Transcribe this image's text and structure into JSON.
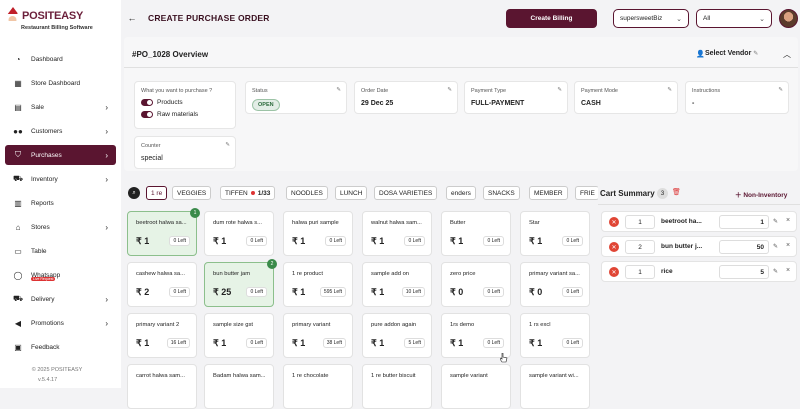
{
  "brand": {
    "name": "POSITEASY",
    "subtitle": "Restaurant Billing Software"
  },
  "sidebar": {
    "items": [
      {
        "label": "Dashboard",
        "icon": "speedometer-icon",
        "chevron": false
      },
      {
        "label": "Store Dashboard",
        "icon": "store-icon",
        "chevron": false
      },
      {
        "label": "Sale",
        "icon": "register-icon",
        "chevron": true
      },
      {
        "label": "Customers",
        "icon": "people-icon",
        "chevron": true
      },
      {
        "label": "Purchases",
        "icon": "basket-icon",
        "chevron": true,
        "active": true
      },
      {
        "label": "Inventory",
        "icon": "cart-icon",
        "chevron": true
      },
      {
        "label": "Reports",
        "icon": "report-icon",
        "chevron": false
      },
      {
        "label": "Stores",
        "icon": "stores-icon",
        "chevron": true
      },
      {
        "label": "Table",
        "icon": "table-icon",
        "chevron": false
      },
      {
        "label": "Whatsapp",
        "icon": "whatsapp-icon",
        "chevron": false,
        "badge": "Live Request"
      },
      {
        "label": "Delivery",
        "icon": "truck-icon",
        "chevron": true
      },
      {
        "label": "Promotions",
        "icon": "megaphone-icon",
        "chevron": true
      },
      {
        "label": "Feedback",
        "icon": "feedback-icon",
        "chevron": false
      }
    ],
    "copyright": "© 2025 POSITEASY",
    "version": "v.5.4.17"
  },
  "header": {
    "title": "CREATE PURCHASE ORDER",
    "create_billing": "Create Billing",
    "store_select": "supersweetBiz",
    "filter_select": "All"
  },
  "overview": {
    "title": "#PO_1028 Overview",
    "select_vendor": "Select Vendor",
    "purchase_question": "What you want to purchase ?",
    "toggle_products": "Products",
    "toggle_raw": "Raw materials",
    "status_label": "Status",
    "status_value": "OPEN",
    "order_date_label": "Order Date",
    "order_date_value": "29 Dec 25",
    "payment_type_label": "Payment Type",
    "payment_type_value": "FULL-PAYMENT",
    "payment_mode_label": "Payment Mode",
    "payment_mode_value": "CASH",
    "instructions_label": "Instructions",
    "instructions_value": "-",
    "counter_label": "Counter",
    "counter_value": "special"
  },
  "filters": {
    "chips": [
      "1 re",
      "VEGGIES",
      "TIFFEN",
      "1/33",
      "NOODLES",
      "LUNCH",
      "DOSA VARIETIES",
      "enders",
      "SNACKS",
      "MEMBER",
      "FRIE"
    ]
  },
  "products": [
    {
      "name": "beetroot halwa sa...",
      "price": "₹ 1",
      "left": "0 Left",
      "selected": true,
      "count": "1"
    },
    {
      "name": "dum rote halwa s...",
      "price": "₹ 1",
      "left": "0 Left"
    },
    {
      "name": "halwa puri sample",
      "price": "₹ 1",
      "left": "0 Left"
    },
    {
      "name": "walnut halwa sam...",
      "price": "₹ 1",
      "left": "0 Left"
    },
    {
      "name": "Butter",
      "price": "₹ 1",
      "left": "0 Left"
    },
    {
      "name": "Star",
      "price": "₹ 1",
      "left": "0 Left"
    },
    {
      "name": "cashew halwa sa...",
      "price": "₹ 2",
      "left": "0 Left"
    },
    {
      "name": "bun butter jam",
      "price": "₹ 25",
      "left": "0 Left",
      "selected": true,
      "count": "2"
    },
    {
      "name": "1 re product",
      "price": "₹ 1",
      "left": "595 Left"
    },
    {
      "name": "sample add on",
      "price": "₹ 1",
      "left": "10 Left"
    },
    {
      "name": "zero price",
      "price": "₹ 0",
      "left": "0 Left"
    },
    {
      "name": "primary variant sa...",
      "price": "₹ 0",
      "left": "0 Left"
    },
    {
      "name": "primary variant 2",
      "price": "₹ 1",
      "left": "16 Left"
    },
    {
      "name": "sample size gst",
      "price": "₹ 1",
      "left": "0 Left"
    },
    {
      "name": "primary variant",
      "price": "₹ 1",
      "left": "38 Left"
    },
    {
      "name": "pure addon again",
      "price": "₹ 1",
      "left": "5 Left"
    },
    {
      "name": "1rs demo",
      "price": "₹ 1",
      "left": "0 Left"
    },
    {
      "name": "1 rs excl",
      "price": "₹ 1",
      "left": "0 Left"
    },
    {
      "name": "carrot halwa sam...",
      "price": "",
      "left": ""
    },
    {
      "name": "Badam halwa sam...",
      "price": "",
      "left": ""
    },
    {
      "name": "1 re chocolate",
      "price": "",
      "left": ""
    },
    {
      "name": "1 re butter biscuit",
      "price": "",
      "left": ""
    },
    {
      "name": "sample variant",
      "price": "",
      "left": ""
    },
    {
      "name": "sample variant wi...",
      "price": "",
      "left": ""
    }
  ],
  "cart": {
    "title": "Cart Summary",
    "count": "3",
    "non_inventory": "Non-Inventory",
    "rows": [
      {
        "qty": "1",
        "name": "beetroot ha...",
        "value": "1"
      },
      {
        "qty": "2",
        "name": "bun butter j...",
        "value": "50"
      },
      {
        "qty": "1",
        "name": "rice",
        "value": "5"
      }
    ]
  },
  "colors": {
    "brand": "#5a1530",
    "selected_card": "#e6f3e6",
    "delete": "#e04535"
  }
}
